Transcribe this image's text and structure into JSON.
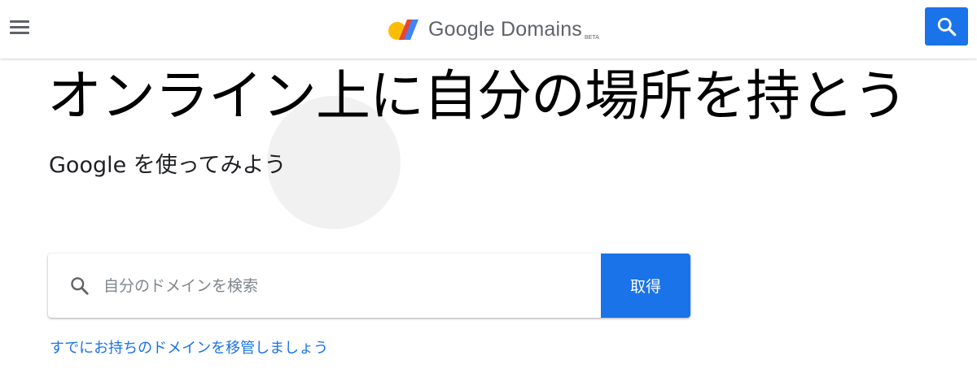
{
  "header": {
    "brand_name": "Google Domains",
    "brand_badge": "BETA",
    "logo": "google-domains-logo",
    "menu_icon": "hamburger-menu-icon",
    "search_icon": "search-icon"
  },
  "hero": {
    "title": "オンライン上に自分の場所を持とう",
    "subtitle": "Google を使ってみよう"
  },
  "search": {
    "placeholder": "自分のドメインを検索",
    "value": "",
    "icon": "search-icon",
    "submit_label": "取得"
  },
  "links": {
    "transfer": "すでにお持ちのドメインを移管しましょう"
  },
  "colors": {
    "accent": "#1a73e8",
    "logo_yellow": "#fbbc04",
    "logo_red": "#ea4335",
    "logo_blue": "#4285f4",
    "icon_gray": "#5f6368"
  }
}
